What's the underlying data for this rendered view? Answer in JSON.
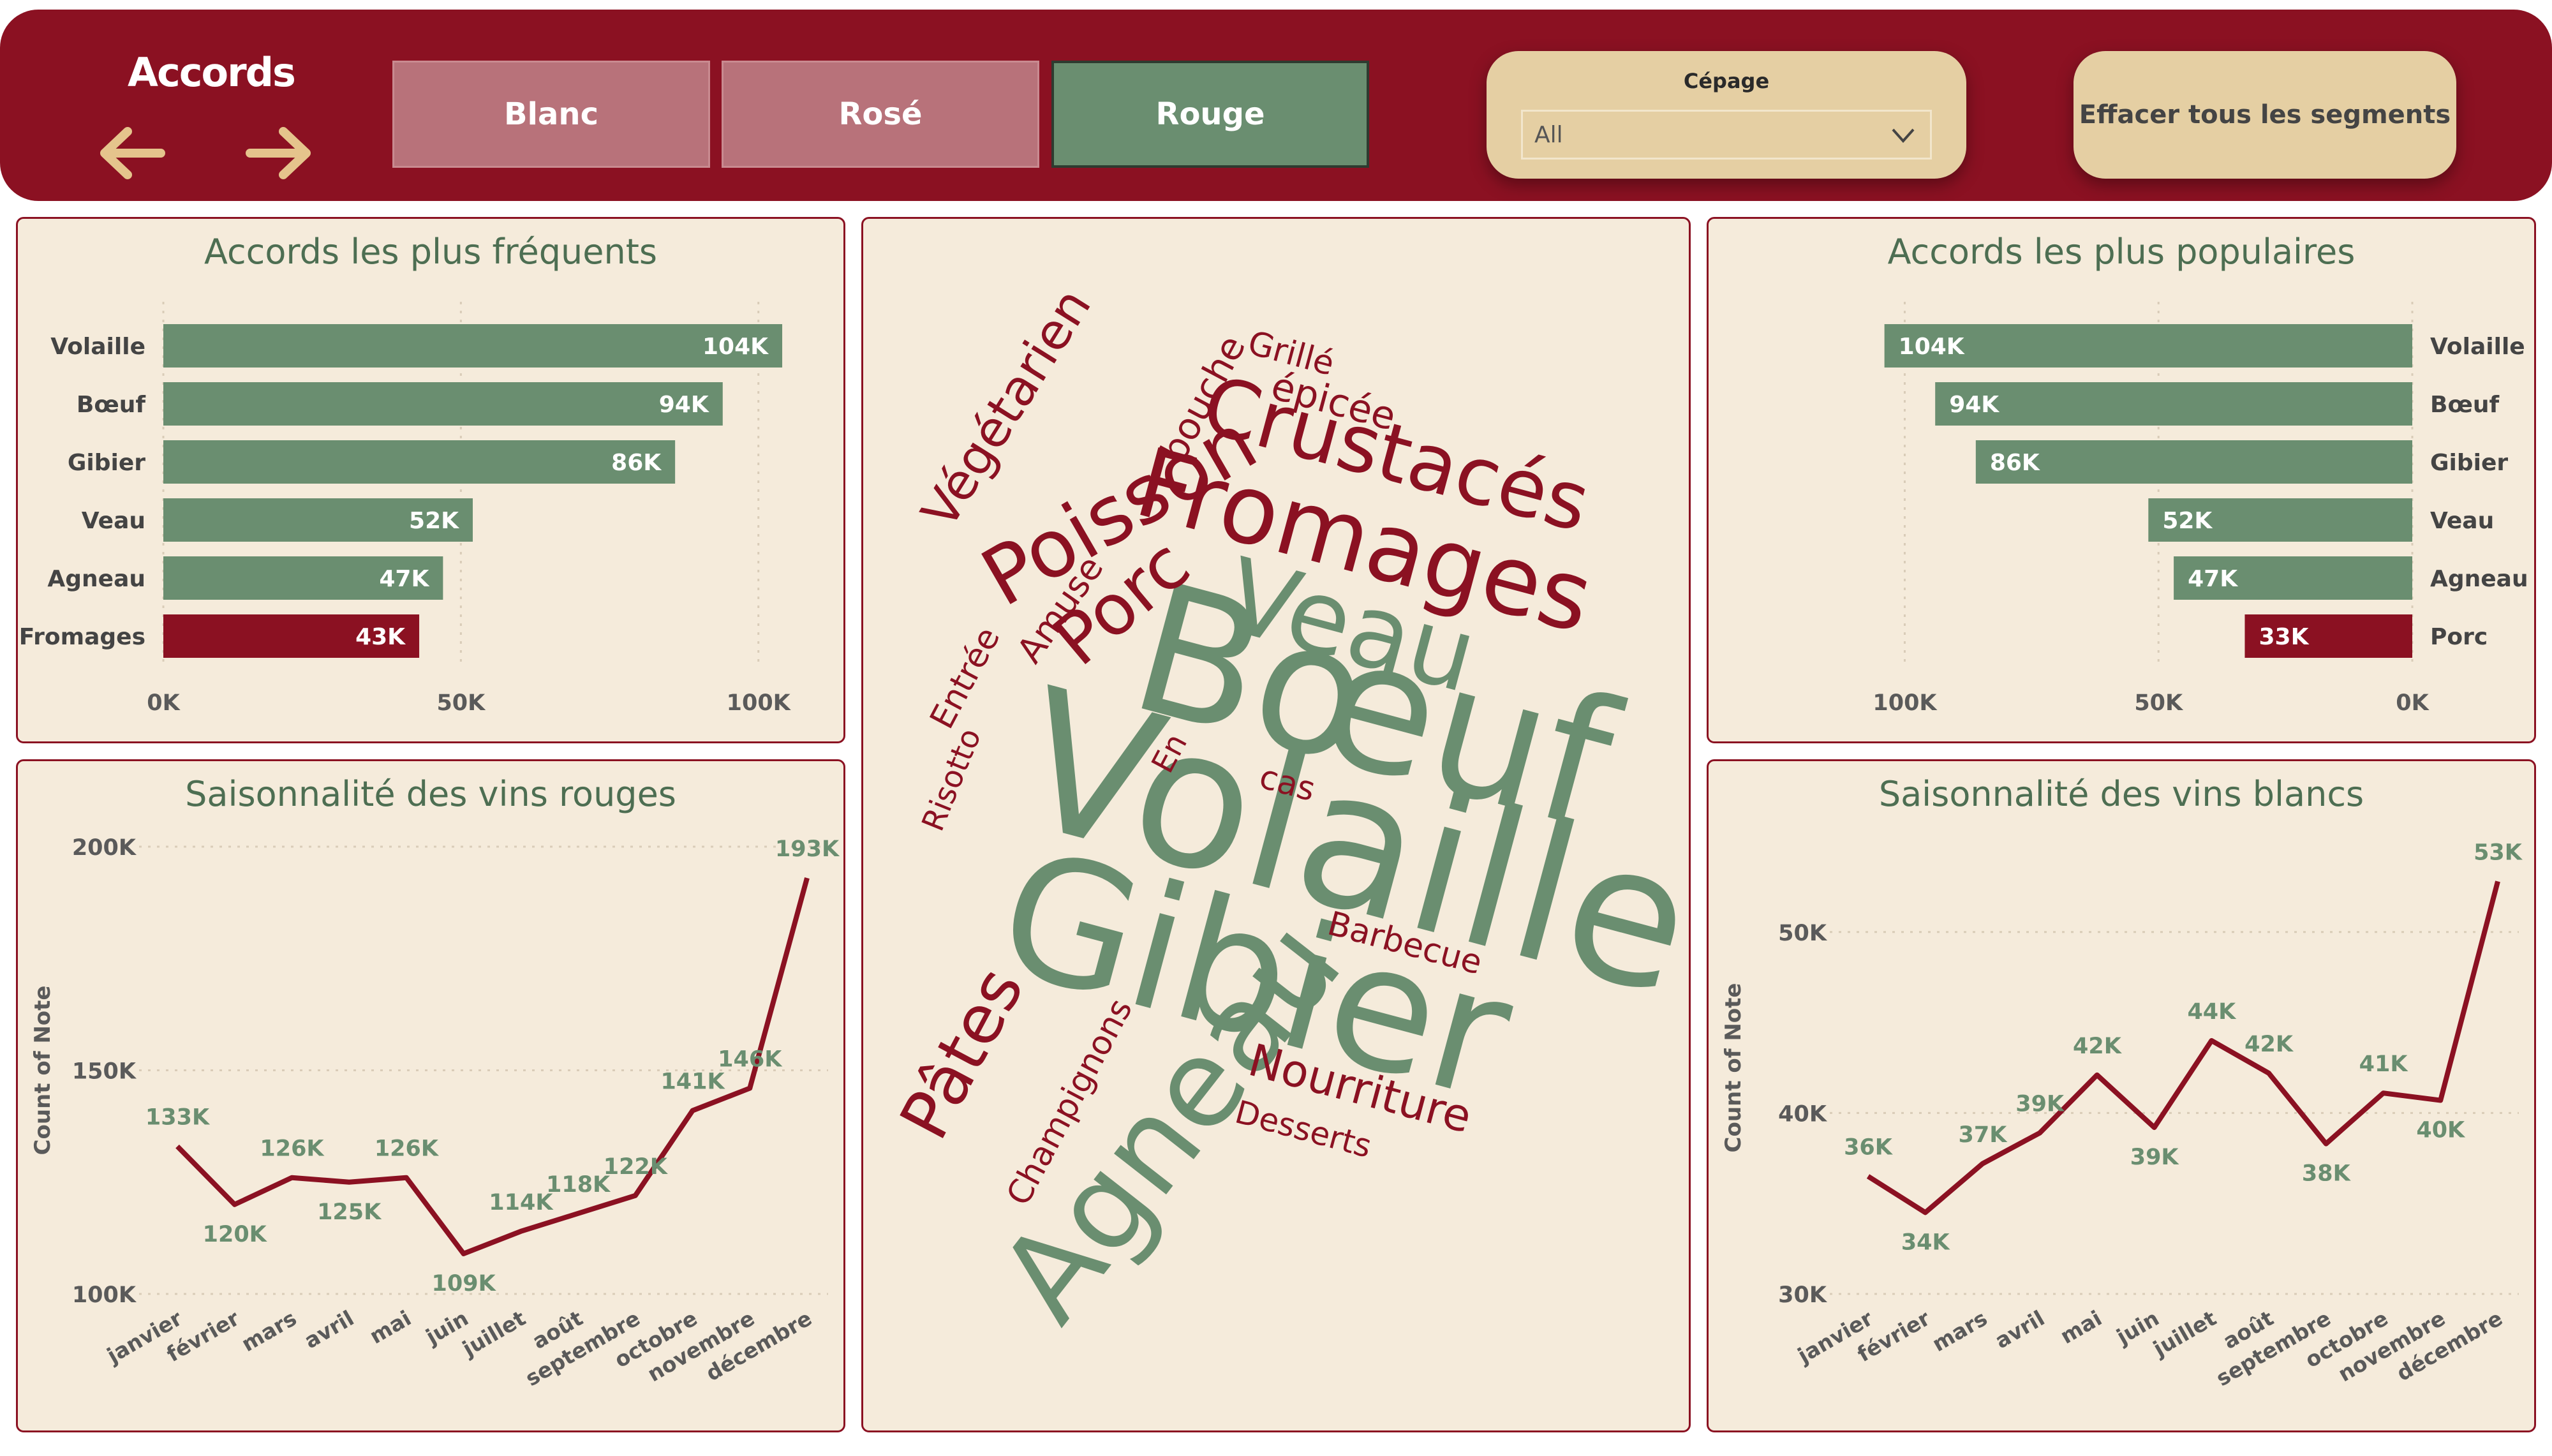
{
  "header": {
    "title": "Accords",
    "back_icon": "arrow-left-icon",
    "forward_icon": "arrow-right-icon",
    "type_buttons": [
      {
        "label": "Blanc",
        "active": false
      },
      {
        "label": "Rosé",
        "active": false
      },
      {
        "label": "Rouge",
        "active": true
      }
    ],
    "cepage": {
      "label": "Cépage",
      "value": "All"
    },
    "clear_label": "Effacer tous les segments"
  },
  "colors": {
    "brand": "#8b1122",
    "green": "#6a8e70",
    "panel_bg": "#f5ebdb",
    "highlight_bar": "#8b1122",
    "button_gold": "#e5cfa3"
  },
  "chart_data": [
    {
      "id": "frequent",
      "type": "bar",
      "orientation": "horizontal",
      "title": "Accords les plus fréquents",
      "categories": [
        "Volaille",
        "Bœuf",
        "Gibier",
        "Veau",
        "Agneau",
        "Fromages"
      ],
      "values": [
        104000,
        94000,
        86000,
        52000,
        47000,
        43000
      ],
      "value_labels": [
        "104K",
        "94K",
        "86K",
        "52K",
        "47K",
        "43K"
      ],
      "highlight": [
        false,
        false,
        false,
        false,
        false,
        true
      ],
      "xlim": [
        0,
        110000
      ],
      "xticks": [
        0,
        50000,
        100000
      ],
      "xtick_labels": [
        "0K",
        "50K",
        "100K"
      ],
      "reversed": false,
      "grid": true
    },
    {
      "id": "popular",
      "type": "bar",
      "orientation": "horizontal",
      "title": "Accords les plus populaires",
      "categories": [
        "Volaille",
        "Bœuf",
        "Gibier",
        "Veau",
        "Agneau",
        "Porc"
      ],
      "values": [
        104000,
        94000,
        86000,
        52000,
        47000,
        33000
      ],
      "value_labels": [
        "104K",
        "94K",
        "86K",
        "52K",
        "47K",
        "33K"
      ],
      "highlight": [
        false,
        false,
        false,
        false,
        false,
        true
      ],
      "xlim": [
        0,
        112000
      ],
      "xticks": [
        100000,
        50000,
        0
      ],
      "xtick_labels": [
        "100K",
        "50K",
        "0K"
      ],
      "reversed": true,
      "grid": true
    },
    {
      "id": "rouges",
      "type": "line",
      "title": "Saisonnalité des vins rouges",
      "ylabel": "Count of Note",
      "categories": [
        "janvier",
        "février",
        "mars",
        "avril",
        "mai",
        "juin",
        "juillet",
        "août",
        "septembre",
        "octobre",
        "novembre",
        "décembre"
      ],
      "values": [
        133000,
        120000,
        126000,
        125000,
        126000,
        109000,
        114000,
        118000,
        122000,
        141000,
        146000,
        193000
      ],
      "value_labels": [
        "133K",
        "120K",
        "126K",
        "125K",
        "126K",
        "109K",
        "114K",
        "118K",
        "122K",
        "141K",
        "146K",
        "193K"
      ],
      "ylim": [
        100000,
        200000
      ],
      "yticks": [
        100000,
        150000,
        200000
      ],
      "ytick_labels": [
        "100K",
        "150K",
        "200K"
      ],
      "grid": true
    },
    {
      "id": "blancs",
      "type": "line",
      "title": "Saisonnalité des vins blancs",
      "ylabel": "Count of Note",
      "categories": [
        "janvier",
        "février",
        "mars",
        "avril",
        "mai",
        "juin",
        "juillet",
        "août",
        "septembre",
        "octobre",
        "novembre",
        "décembre"
      ],
      "values": [
        36500,
        34500,
        37200,
        38900,
        42100,
        39200,
        44000,
        42200,
        38300,
        41100,
        40700,
        52800
      ],
      "value_labels": [
        "36K",
        "34K",
        "37K",
        "39K",
        "42K",
        "39K",
        "44K",
        "42K",
        "38K",
        "41K",
        "40K",
        "53K"
      ],
      "ylim": [
        30000,
        55000
      ],
      "yticks": [
        30000,
        40000,
        50000
      ],
      "ytick_labels": [
        "30K",
        "40K",
        "50K"
      ],
      "grid": true
    }
  ],
  "word_cloud": {
    "words": [
      {
        "text": "Volaille",
        "color": "green"
      },
      {
        "text": "Gibier",
        "color": "green"
      },
      {
        "text": "Bœuf",
        "color": "green"
      },
      {
        "text": "Agneau",
        "color": "green"
      },
      {
        "text": "Veau",
        "color": "green"
      },
      {
        "text": "Fromages",
        "color": "red"
      },
      {
        "text": "Crustacés",
        "color": "red"
      },
      {
        "text": "Poisson",
        "color": "red"
      },
      {
        "text": "Porc",
        "color": "red"
      },
      {
        "text": "Végétarien",
        "color": "red"
      },
      {
        "text": "Pâtes",
        "color": "red"
      },
      {
        "text": "Nourriture",
        "color": "red"
      },
      {
        "text": "épicée",
        "color": "red"
      },
      {
        "text": "Grillé",
        "color": "red"
      },
      {
        "text": "bouche",
        "color": "red"
      },
      {
        "text": "Amuse",
        "color": "red"
      },
      {
        "text": "Entrée",
        "color": "red"
      },
      {
        "text": "Risotto",
        "color": "red"
      },
      {
        "text": "En",
        "color": "red"
      },
      {
        "text": "cas",
        "color": "red"
      },
      {
        "text": "Barbecue",
        "color": "red"
      },
      {
        "text": "Champignons",
        "color": "red"
      },
      {
        "text": "Desserts",
        "color": "red"
      }
    ]
  }
}
